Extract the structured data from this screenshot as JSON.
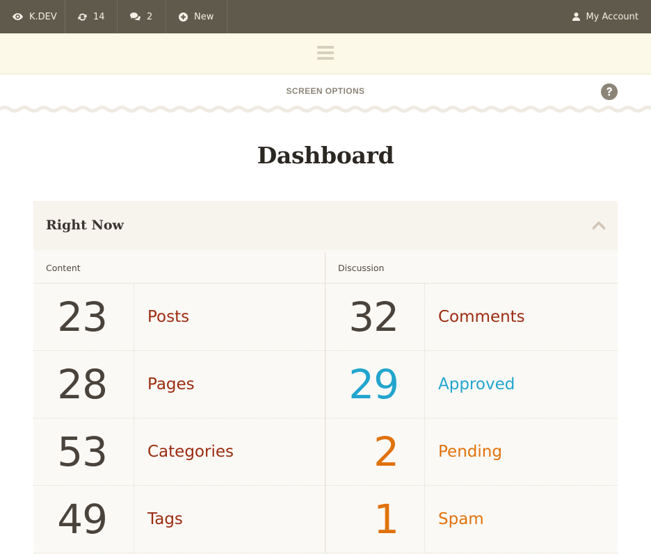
{
  "topbar": {
    "site": {
      "label": "K.DEV",
      "icon": "eye-icon"
    },
    "updates": {
      "label": "14",
      "icon": "refresh-icon"
    },
    "comments": {
      "label": "2",
      "icon": "comments-icon"
    },
    "new": {
      "label": "New",
      "icon": "plus-circle-icon"
    },
    "account": {
      "label": "My Account",
      "icon": "user-icon"
    }
  },
  "menu": {
    "icon": "hamburger-icon"
  },
  "screen_options": {
    "label": "SCREEN OPTIONS",
    "help_icon": "question-circle-icon"
  },
  "page_title": "Dashboard",
  "widget": {
    "title": "Right Now",
    "collapse_icon": "chevron-up-icon",
    "content": {
      "header": "Content",
      "rows": [
        {
          "count": "23",
          "label": "Posts"
        },
        {
          "count": "28",
          "label": "Pages"
        },
        {
          "count": "53",
          "label": "Categories"
        },
        {
          "count": "49",
          "label": "Tags"
        }
      ]
    },
    "discussion": {
      "header": "Discussion",
      "rows": [
        {
          "count": "32",
          "label": "Comments",
          "color": "#9b2c10",
          "num_color": "#4a433b"
        },
        {
          "count": "29",
          "label": "Approved",
          "color": "#21a5ce",
          "num_color": "#21a5ce"
        },
        {
          "count": "2",
          "label": "Pending",
          "color": "#e0720c",
          "num_color": "#e0720c"
        },
        {
          "count": "1",
          "label": "Spam",
          "color": "#e0720c",
          "num_color": "#e0720c"
        }
      ]
    }
  },
  "colors": {
    "topbar": "#5f5a4c",
    "menubar": "#fdf9e8",
    "link": "#9b2c10",
    "approved": "#21a5ce",
    "pending": "#e0720c"
  }
}
